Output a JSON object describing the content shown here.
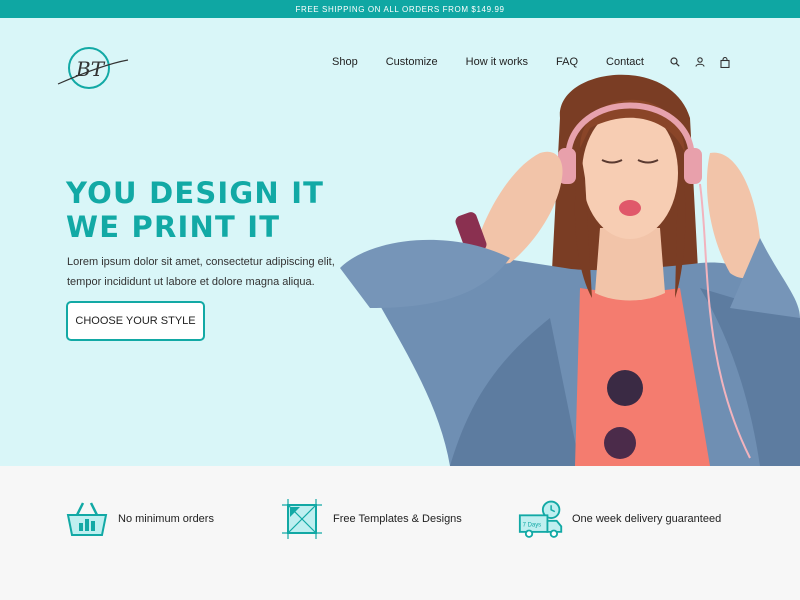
{
  "topbar": {
    "text": "FREE SHIPPING  ON ALL ORDERS  FROM $149.99"
  },
  "logo": {
    "text": "BT"
  },
  "nav": {
    "items": [
      "Shop",
      "Customize",
      "How it works",
      "FAQ",
      "Contact"
    ]
  },
  "nav_icons": [
    "search-icon",
    "user-icon",
    "bag-icon"
  ],
  "hero": {
    "headline_1": "YOU DESIGN IT",
    "headline_2": "WE PRINT IT",
    "lead_1": "Lorem ipsum dolor sit amet, consectetur adipiscing elit,",
    "lead_2": "tempor incididunt ut labore et dolore magna aliqua.",
    "cta": "CHOOSE YOUR STYLE"
  },
  "features": [
    {
      "icon": "basket-icon",
      "label": "No minimum orders"
    },
    {
      "icon": "template-grid-icon",
      "label": "Free Templates & Designs"
    },
    {
      "icon": "delivery-truck-icon",
      "label": "One week delivery guaranteed",
      "badge": "7 Days"
    }
  ],
  "colors": {
    "accent": "#12a9a5",
    "topbar": "#0fa7a3",
    "hero_bg": "#d9f6f8",
    "features_bg": "#f7f7f7"
  }
}
